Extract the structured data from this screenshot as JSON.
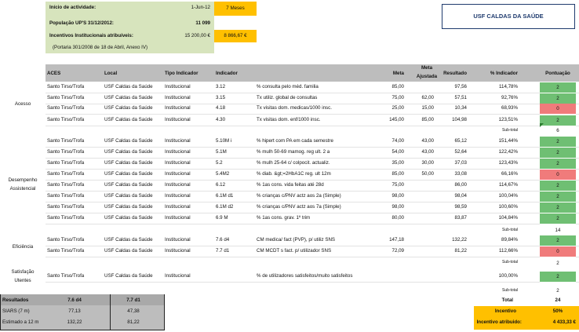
{
  "info": {
    "start_label": "Início de actividade:",
    "start_value": "1-Jun-12",
    "months_badge": "7 Meses",
    "population_label": "População UP'S 31/12/2012:",
    "population_value": "11 099",
    "incentive_label": "Incentivos Institucionais atribuíveis:",
    "incentive_value": "15 200,00 €",
    "incentive_badge": "8 866,67 €",
    "legal_note": "(Portaria 301/2008 de 18 de Abril, Anexo IV)"
  },
  "unit_title": "USF CALDAS DA SAÚDE",
  "headers": {
    "aces": "ACES",
    "local": "Local",
    "tipo": "Tipo Indicador",
    "indicador": "Indicador",
    "meta": "Meta",
    "meta_aj_1": "Meta",
    "meta_aj_2": "Ajustada",
    "resultado": "Resultado",
    "pct": "% Indicador",
    "pontuacao": "Pontuação"
  },
  "groups": {
    "acesso": "Acesso",
    "desempenho_1": "Desempenho",
    "desempenho_2": "Assistencial",
    "eficiencia": "Eficiência",
    "satisfacao_1": "Satisfação",
    "satisfacao_2": "Utentes"
  },
  "rows": [
    {
      "aces": "Santo Tirso/Trofa",
      "local": "USF Caldas da Saúde",
      "tipo": "Institucional",
      "code": "3.12",
      "desc": "% consulta pelo méd. familia",
      "meta": "85,00",
      "meta_aj": "",
      "res": "97,56",
      "pct": "114,78%",
      "pont": "2"
    },
    {
      "aces": "Santo Tirso/Trofa",
      "local": "USF Caldas da Saúde",
      "tipo": "Institucional",
      "code": "3.15",
      "desc": "Tx utiliz. global de consultas",
      "meta": "75,00",
      "meta_aj": "62,00",
      "res": "57,51",
      "pct": "92,76%",
      "pont": "2"
    },
    {
      "aces": "Santo Tirso/Trofa",
      "local": "USF Caldas da Saúde",
      "tipo": "Institucional",
      "code": "4.18",
      "desc": "Tx visitas dom. medicas/1000 insc.",
      "meta": "25,00",
      "meta_aj": "15,00",
      "res": "10,34",
      "pct": "68,93%",
      "pont": "0"
    },
    {
      "aces": "Santo Tirso/Trofa",
      "local": "USF Caldas da Saúde",
      "tipo": "Institucional",
      "code": "4.30",
      "desc": "Tx visitas dom. enf/1000 insc.",
      "meta": "145,00",
      "meta_aj": "85,00",
      "res": "104,98",
      "pct": "123,51%",
      "pont": "2"
    },
    {
      "aces": "Santo Tirso/Trofa",
      "local": "USF Caldas da Saúde",
      "tipo": "Institucional",
      "code": "5.10M i",
      "desc": "% hipert com PA em cada semestre",
      "meta": "74,00",
      "meta_aj": "43,00",
      "res": "65,12",
      "pct": "151,44%",
      "pont": "2"
    },
    {
      "aces": "Santo Tirso/Trofa",
      "local": "USF Caldas da Saúde",
      "tipo": "Institucional",
      "code": "5.1M",
      "desc": "% mulh 50-69 mamog. reg ult. 2 a",
      "meta": "54,00",
      "meta_aj": "43,00",
      "res": "52,64",
      "pct": "122,42%",
      "pont": "2"
    },
    {
      "aces": "Santo Tirso/Trofa",
      "local": "USF Caldas da Saúde",
      "tipo": "Institucional",
      "code": "5.2",
      "desc": "% mulh 25-64 c/ colpocit. actualiz.",
      "meta": "35,00",
      "meta_aj": "30,00",
      "res": "37,03",
      "pct": "123,43%",
      "pont": "2"
    },
    {
      "aces": "Santo Tirso/Trofa",
      "local": "USF Caldas da Saúde",
      "tipo": "Institucional",
      "code": "5.4M2",
      "desc": "% diab. &gt;=2HbA1C reg. ult 12m",
      "meta": "85,00",
      "meta_aj": "50,00",
      "res": "33,08",
      "pct": "66,16%",
      "pont": "0"
    },
    {
      "aces": "Santo Tirso/Trofa",
      "local": "USF Caldas da Saúde",
      "tipo": "Institucional",
      "code": "6.12",
      "desc": "% 1as cons. vida feitas até 28d",
      "meta": "75,00",
      "meta_aj": "",
      "res": "86,00",
      "pct": "114,67%",
      "pont": "2"
    },
    {
      "aces": "Santo Tirso/Trofa",
      "local": "USF Caldas da Saúde",
      "tipo": "Institucional",
      "code": "6.1M d1",
      "desc": "% crianças c/PNV actz aos 2a (Simple)",
      "meta": "98,00",
      "meta_aj": "",
      "res": "98,04",
      "pct": "100,04%",
      "pont": "2"
    },
    {
      "aces": "Santo Tirso/Trofa",
      "local": "USF Caldas da Saúde",
      "tipo": "Institucional",
      "code": "6.1M d2",
      "desc": "% crianças c/PNV actz aos 7a (Simple)",
      "meta": "98,00",
      "meta_aj": "",
      "res": "98,59",
      "pct": "100,60%",
      "pont": "2"
    },
    {
      "aces": "Santo Tirso/Trofa",
      "local": "USF Caldas da Saúde",
      "tipo": "Institucional",
      "code": "6.9 M",
      "desc": "% 1as cons. grav. 1º trim",
      "meta": "80,00",
      "meta_aj": "",
      "res": "83,87",
      "pct": "104,84%",
      "pont": "2"
    },
    {
      "aces": "Santo Tirso/Trofa",
      "local": "USF Caldas da Saúde",
      "tipo": "Institucional",
      "code": "7.6 d4",
      "desc": "CM medica/ fact (PVP), p/ utiliz SNS",
      "meta": "147,18",
      "meta_aj": "",
      "res": "132,22",
      "pct": "89,84%",
      "pont": "2"
    },
    {
      "aces": "Santo Tirso/Trofa",
      "local": "USF Caldas da Saúde",
      "tipo": "Institucional",
      "code": "7.7 d1",
      "desc": "CM MCDT s fact. p/ utilizador SNS",
      "meta": "72,09",
      "meta_aj": "",
      "res": "81,22",
      "pct": "112,66%",
      "pont": "0"
    },
    {
      "aces": "Santo Tirso/Trofa",
      "local": "USF Caldas da Saúde",
      "tipo": "Institucional",
      "code": "",
      "desc": "% de utilizadores satisfeitos/muito satisfeitos",
      "meta": "",
      "meta_aj": "",
      "res": "",
      "pct": "100,00%",
      "pont": "2"
    }
  ],
  "subtotals": {
    "label": "Sub-total",
    "acesso": "6",
    "desempenho": "14",
    "eficiencia": "2",
    "satisfacao": "2"
  },
  "totals": {
    "total_label": "Total",
    "total_value": "24",
    "incentivo_label": "Incentivo",
    "incentivo_value": "50%",
    "atribuido_label": "Incentivo atribuido:",
    "atribuido_value": "4 433,33 €"
  },
  "results_table": {
    "header_label": "Resultados",
    "col1": "7.6 d4",
    "col2": "7.7 d1",
    "row1_label": "SIARS (7 m)",
    "row1_v1": "77,13",
    "row1_v2": "47,38",
    "row2_label": "Estimado a 12 m",
    "row2_v1": "132,22",
    "row2_v2": "81,22"
  }
}
